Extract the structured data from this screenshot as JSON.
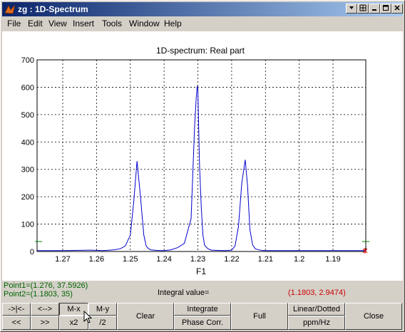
{
  "window": {
    "title": "zg : 1D-Spectrum"
  },
  "menu": {
    "items": [
      "File",
      "Edit",
      "View",
      "Insert",
      "Tools",
      "Window",
      "Help"
    ]
  },
  "plot": {
    "title": "1D-spectrum: Real part",
    "xlabel": "F1"
  },
  "chart_data": {
    "type": "line",
    "title": "1D-spectrum: Real part",
    "xlabel": "F1",
    "ylabel": "",
    "xlim": [
      1.2776,
      1.1803
    ],
    "ylim": [
      0,
      700
    ],
    "x_reversed": true,
    "grid": true,
    "xticks": [
      "1.27",
      "1.26",
      "1.25",
      "1.24",
      "1.23",
      "1.22",
      "1.21",
      "1.2",
      "1.19"
    ],
    "yticks": [
      "0",
      "100",
      "200",
      "300",
      "400",
      "500",
      "600",
      "700"
    ],
    "series": [
      {
        "color": "#0000cc",
        "x": [
          1.2776,
          1.27,
          1.262,
          1.258,
          1.255,
          1.253,
          1.2515,
          1.25,
          1.249,
          1.248,
          1.247,
          1.246,
          1.2453,
          1.2446,
          1.2438,
          1.243,
          1.242,
          1.241,
          1.24,
          1.238,
          1.236,
          1.234,
          1.232,
          1.231,
          1.2305,
          1.2302,
          1.23,
          1.2298,
          1.2295,
          1.229,
          1.2285,
          1.228,
          1.227,
          1.226,
          1.224,
          1.222,
          1.22,
          1.219,
          1.218,
          1.217,
          1.216,
          1.2153,
          1.2146,
          1.2138,
          1.213,
          1.212,
          1.211,
          1.21,
          1.205,
          1.2,
          1.19,
          1.1803
        ],
        "y": [
          3,
          3,
          5,
          3,
          6,
          10,
          20,
          60,
          180,
          330,
          200,
          60,
          20,
          10,
          6,
          5,
          4,
          3,
          3,
          6,
          14,
          30,
          120,
          450,
          560,
          605,
          590,
          470,
          310,
          160,
          60,
          22,
          10,
          5,
          4,
          3,
          5,
          20,
          90,
          250,
          335,
          240,
          80,
          24,
          10,
          6,
          4,
          3,
          3,
          3,
          3,
          3
        ]
      }
    ]
  },
  "status": {
    "point1": "Point1=(1.276, 37.5926)",
    "point2": "Point2=(1.1803, 35)",
    "integral_label": "Integral value=",
    "integral_value": "(1.1803, 2.9474)"
  },
  "buttons": {
    "pan_left": "->|<-",
    "pan_out": "<-->",
    "mx": "M-x",
    "my": "M-y",
    "scroll_left": "<<",
    "scroll_right": ">>",
    "x2": "x2",
    "div2": "/2",
    "clear": "Clear",
    "integrate": "Integrate",
    "phase_corr": "Phase Corr.",
    "full": "Full",
    "linear_dotted": "Linear/Dotted",
    "ppm_hz": "ppm/Hz",
    "close": "Close"
  },
  "colors": {
    "title_start": "#0a246a",
    "title_end": "#a6caf0",
    "series": "#0000cc",
    "cursor_green": "#008000",
    "status_green": "#006400",
    "integral_red": "#cc0000"
  }
}
